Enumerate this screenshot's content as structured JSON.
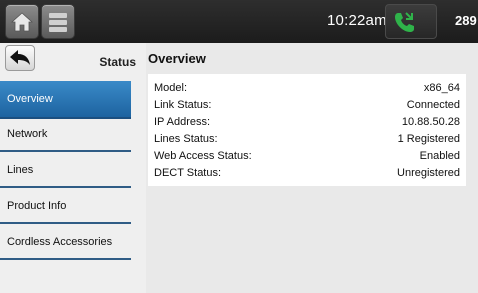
{
  "header": {
    "time": "10:22am",
    "extension": "289",
    "home_icon": "home-icon",
    "menu_icon": "menu-icon",
    "call_icon": "phone-icon",
    "accent": "#2fb34a"
  },
  "sidebar": {
    "title": "Status",
    "items": [
      {
        "label": "Overview"
      },
      {
        "label": "Network"
      },
      {
        "label": "Lines"
      },
      {
        "label": "Product Info"
      },
      {
        "label": "Cordless Accessories"
      }
    ]
  },
  "main": {
    "title": "Overview",
    "rows": [
      {
        "label": "Model:",
        "value": "x86_64"
      },
      {
        "label": "Link Status:",
        "value": "Connected"
      },
      {
        "label": "IP Address:",
        "value": "10.88.50.28"
      },
      {
        "label": "Lines Status:",
        "value": "1 Registered"
      },
      {
        "label": "Web Access Status:",
        "value": "Enabled"
      },
      {
        "label": "DECT Status:",
        "value": "Unregistered"
      }
    ]
  }
}
